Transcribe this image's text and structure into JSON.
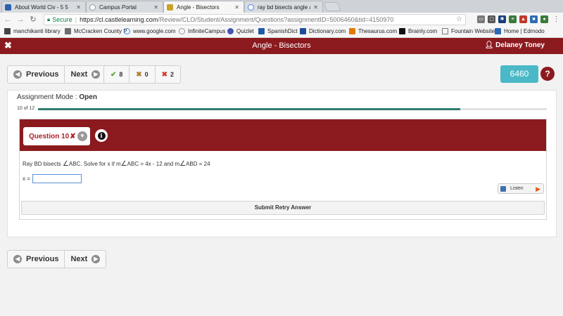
{
  "browser": {
    "tabs": [
      {
        "title": "About World Civ - 5 5",
        "active": false
      },
      {
        "title": "Campus Portal",
        "active": false
      },
      {
        "title": "Angle - Bisectors",
        "active": true
      },
      {
        "title": "ray bd bisects angle ab",
        "active": false
      }
    ],
    "tab_close": "✕",
    "address": {
      "security_label": "Secure",
      "url_host": "https://cl.castlelearning.com",
      "url_path": "/Review/CLO/Student/Assignment/Questions?assignmentID=5006460&tid=4150970"
    },
    "bookmarks": [
      "manchikanti library",
      "McCracken County P",
      "www.google.com",
      "InfiniteCampus",
      "Quizlet",
      "SpanishDict",
      "Dictionary.com",
      "Thesaurus.com",
      "Brainly.com",
      "Fountain Website",
      "Home | Edmodo"
    ]
  },
  "app": {
    "close_glyph": "✖",
    "title": "Angle - Bisectors",
    "user_name": "Delaney Toney"
  },
  "nav": {
    "previous_label": "Previous",
    "next_label": "Next"
  },
  "stats": {
    "correct": "8",
    "partial": "0",
    "incorrect": "2"
  },
  "assignment_id": "6460",
  "help_label": "?",
  "assignment": {
    "mode_label": "Assignment Mode :",
    "mode_value": "Open",
    "progress_text": "10 of 12",
    "progress_fraction": 0.83
  },
  "question": {
    "label": "Question 10",
    "status_mark": "✘",
    "info_label": "i",
    "text_part1": "Ray BD bisects ",
    "text_part2": "ABC. Solve for x if m",
    "text_part3": "ABC = 4x - 12 and m",
    "text_part4": "ABD = 24",
    "angle_symbol": "∠",
    "answer_label": "x =",
    "answer_value": "",
    "listen_label": "Listen",
    "submit_label": "Submit Retry Answer"
  },
  "colors": {
    "brand": "#8b1a1f",
    "badge": "#4bb8c7",
    "progress": "#2f7c6e"
  }
}
